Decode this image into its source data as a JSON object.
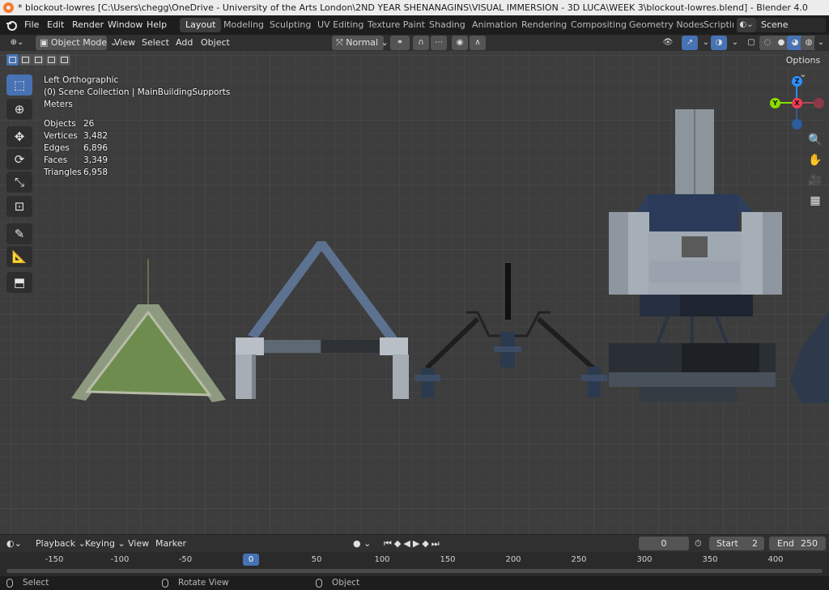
{
  "window": {
    "title": "* blockout-lowres [C:\\Users\\chegg\\OneDrive - University of the Arts London\\2ND YEAR SHENANAGINS\\VISUAL IMMERSION - 3D LUCA\\WEEK 3\\blockout-lowres.blend] - Blender 4.0"
  },
  "menu": [
    "File",
    "Edit",
    "Render",
    "Window",
    "Help"
  ],
  "workspaces": [
    "Layout",
    "Modeling",
    "Sculpting",
    "UV Editing",
    "Texture Paint",
    "Shading",
    "Animation",
    "Rendering",
    "Compositing",
    "Geometry Nodes",
    "Scriptin"
  ],
  "active_workspace": "Layout",
  "scene": {
    "name": "Scene"
  },
  "header": {
    "mode": "Object Mode",
    "menus": [
      "View",
      "Select",
      "Add",
      "Object"
    ],
    "orientation": "Normal",
    "options_label": "Options"
  },
  "viewport": {
    "view_name": "Left Orthographic",
    "collection": "(0) Scene Collection | MainBuildingSupports",
    "units": "Meters",
    "stats": [
      {
        "label": "Objects",
        "value": "26"
      },
      {
        "label": "Vertices",
        "value": "3,482"
      },
      {
        "label": "Edges",
        "value": "6,896"
      },
      {
        "label": "Faces",
        "value": "3,349"
      },
      {
        "label": "Triangles",
        "value": "6,958"
      }
    ],
    "gizmo": {
      "z": "Z",
      "y": "Y",
      "x": "X"
    }
  },
  "tools": [
    "select-box",
    "cursor",
    "move",
    "rotate",
    "scale",
    "transform",
    "annotate",
    "measure",
    "add-cube"
  ],
  "timeline": {
    "menus": [
      "Playback",
      "Keying",
      "View",
      "Marker"
    ],
    "current_frame": "0",
    "start_label": "Start",
    "start": "2",
    "end_label": "End",
    "end": "250",
    "ruler": [
      {
        "frame": -150,
        "label": "-150"
      },
      {
        "frame": -100,
        "label": "-100"
      },
      {
        "frame": -50,
        "label": "-50"
      },
      {
        "frame": 50,
        "label": "50"
      },
      {
        "frame": 100,
        "label": "100"
      },
      {
        "frame": 150,
        "label": "150"
      },
      {
        "frame": 200,
        "label": "200"
      },
      {
        "frame": 250,
        "label": "250"
      },
      {
        "frame": 300,
        "label": "300"
      },
      {
        "frame": 350,
        "label": "350"
      },
      {
        "frame": 400,
        "label": "400"
      }
    ],
    "playhead_label": "0"
  },
  "status": {
    "select": "Select",
    "rotate": "Rotate View",
    "object": "Object"
  },
  "colors": {
    "accent": "#4772b3",
    "x_axis": "#f03c54",
    "y_axis": "#8bdc00",
    "z_axis": "#2c8fff"
  }
}
